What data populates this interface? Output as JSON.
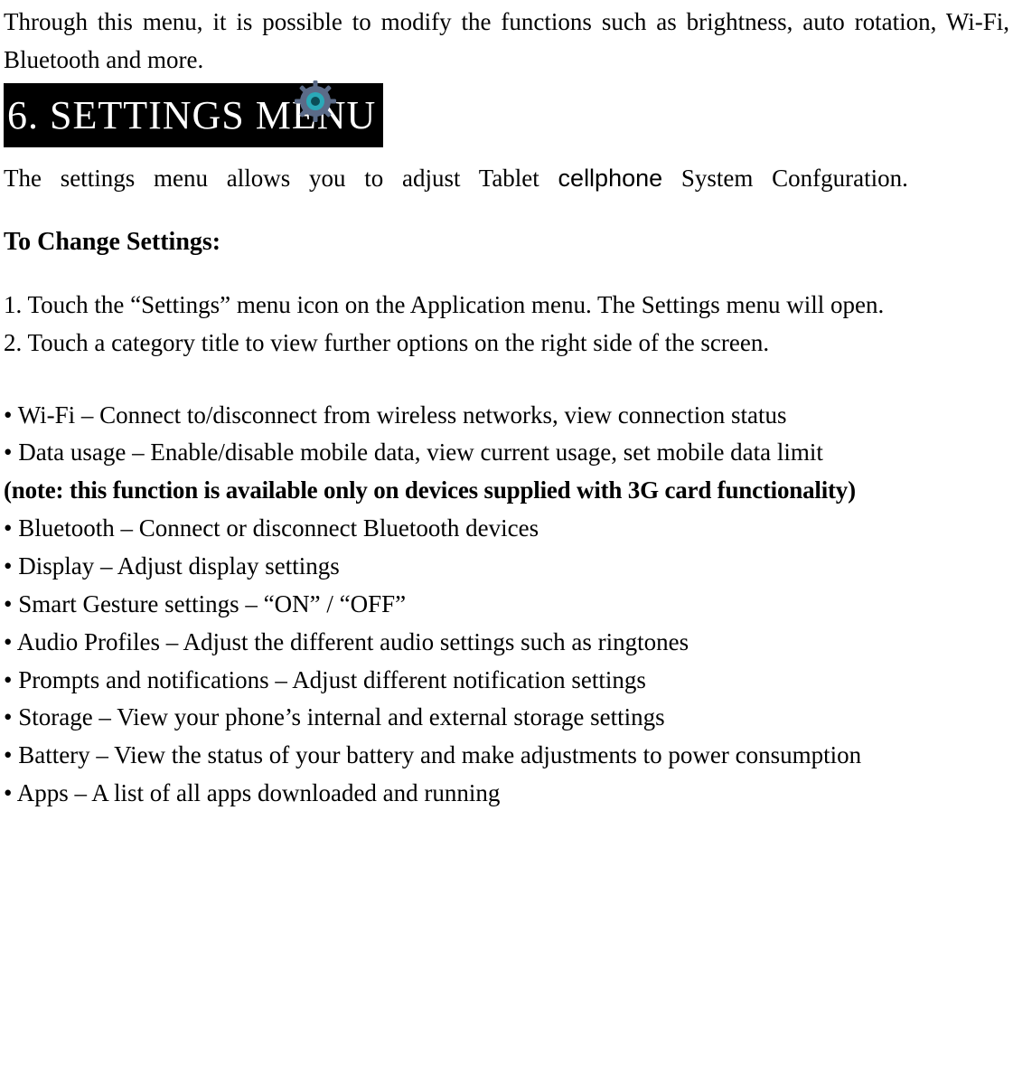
{
  "intro": "Through this menu, it is possible to modify the functions such as brightness, auto rotation, Wi-Fi, Bluetooth and more.",
  "heading": "6. SETTINGS MENU",
  "intro2_a": "The settings menu allows you to adjust Tablet ",
  "intro2_cell": "cellphone",
  "intro2_b": " System Confguration.",
  "subhead": "To Change Settings:",
  "step1": "1. Touch the “Settings”         menu icon on the Application menu. The Settings menu will open.",
  "step2": "2. Touch a category title to view further options on the right side of the screen.",
  "b1": "• Wi-Fi – Connect to/disconnect from wireless networks, view connection status",
  "b2": "• Data usage – Enable/disable mobile data, view current usage, set mobile data limit",
  "note": "(note: this function is available only on devices supplied with 3G card functionality)",
  "b3": "• Bluetooth – Connect or disconnect Bluetooth devices",
  "b4": "• Display – Adjust display settings",
  "b5": "• Smart Gesture settings – “ON” / “OFF”",
  "b6": "• Audio Profiles – Adjust the different audio settings such as ringtones",
  "b7": "• Prompts and notifications – Adjust different notification settings",
  "b8": "• Storage – View your phone’s internal and external storage settings",
  "b9": "• Battery – View the status of your battery and make adjustments to power consumption",
  "b10": "• Apps – A list of all apps downloaded and running"
}
